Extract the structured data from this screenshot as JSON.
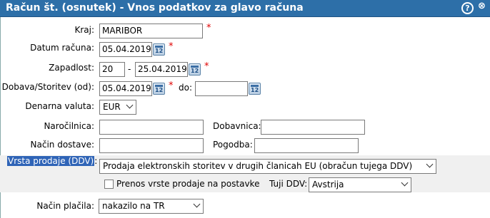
{
  "window": {
    "title": "Račun št. (osnutek) - Vnos podatkov za glavo računa",
    "help_icon": "?",
    "close_icon": "⊗"
  },
  "form": {
    "kraj": {
      "label": "Kraj:",
      "value": "MARIBOR"
    },
    "datum_racuna": {
      "label": "Datum računa:",
      "value": "05.04.2019"
    },
    "zapadlost": {
      "label": "Zapadlost:",
      "days": "20",
      "dash": "-",
      "date": "25.04.2019"
    },
    "dobava": {
      "label": "Dobava/Storitev (od):",
      "value": "05.04.2019",
      "do_label": "do:",
      "do_value": ""
    },
    "denarna_valuta": {
      "label": "Denarna valuta:",
      "value": "EUR"
    },
    "narocilnica": {
      "label": "Naročilnica:",
      "value": ""
    },
    "dobavnica": {
      "label": "Dobavnica:",
      "value": ""
    },
    "nacin_dostave": {
      "label": "Način dostave:",
      "value": ""
    },
    "pogodba": {
      "label": "Pogodba:",
      "value": ""
    },
    "vrsta_prodaje": {
      "label": "Vrsta prodaje (DDV)",
      "colon": ":",
      "value": "Prodaja elektronskih storitev v drugih članicah EU (obračun tujega DDV)"
    },
    "prenos": {
      "label": "Prenos vrste prodaje na postavke",
      "checked": false
    },
    "tuji_ddv": {
      "label": "Tuji DDV:",
      "value": "Avstrija"
    },
    "nacin_placila": {
      "label": "Način plačila:",
      "value": "nakazilo na TR"
    },
    "required_mark": "*"
  },
  "colors": {
    "titlebar": "#2d6fa8",
    "highlight": "#2f64b7",
    "required": "#e00000"
  }
}
